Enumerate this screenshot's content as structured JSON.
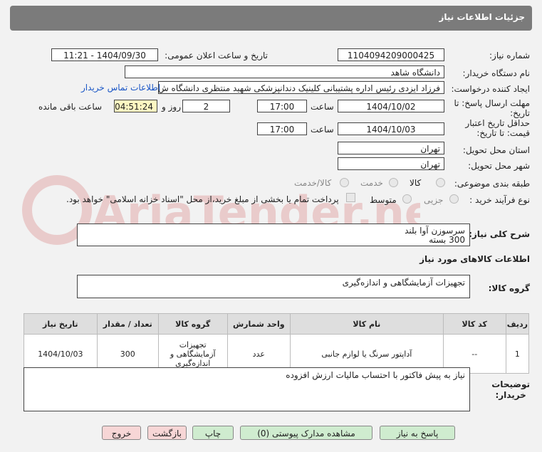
{
  "header": {
    "title": "جزئیات اطلاعات نیاز"
  },
  "fields": {
    "need_number_label": "شماره نیاز:",
    "need_number": "1104094209000425",
    "announce_label": "تاریخ و ساعت اعلان عمومی:",
    "announce_value": "1404/09/30 - 11:21",
    "buyer_org_label": "نام دستگاه خریدار:",
    "buyer_org": "دانشگاه شاهد",
    "creator_label": "ایجاد کننده درخواست:",
    "creator": "فرزاد ایزدی رئیس اداره پشتیبانی کلینیک دندانپزشکی شهید منتظری دانشگاه ش",
    "contact_link": "اطلاعات تماس خریدار",
    "deadline_label": "مهلت ارسال پاسخ: تا تاریخ:",
    "deadline_date": "1404/10/02",
    "time_label": "ساعت",
    "deadline_time": "17:00",
    "days_value": "2",
    "days_label": "روز و",
    "remaining_time": "04:51:24",
    "remaining_label": "ساعت باقی مانده",
    "validity_label": "حداقل تاریخ اعتبار قیمت: تا تاریخ:",
    "validity_date": "1404/10/03",
    "validity_time": "17:00",
    "province_label": "استان محل تحویل:",
    "province": "تهران",
    "city_label": "شهر محل تحویل:",
    "city": "تهران",
    "category_label": "طبقه بندی موضوعی:",
    "category_options": [
      "کالا",
      "خدمت",
      "کالا/خدمت"
    ],
    "process_label": "نوع فرآیند خرید :",
    "process_options": [
      "جزیی",
      "متوسط"
    ],
    "payment_note": "پرداخت تمام یا بخشی از مبلغ خرید،از محل \"اسناد خزانه اسلامی\" خواهد بود."
  },
  "summary": {
    "label": "شرح کلی نیاز:",
    "line1": "سرسوزن آوا بلند",
    "line2": "300 بسته"
  },
  "goods": {
    "section_title": "اطلاعات کالاهای مورد نیاز",
    "group_label": "گروه کالا:",
    "group_value": "تجهیزات آزمایشگاهی و اندازه‌گیری"
  },
  "table": {
    "headers": [
      "ردیف",
      "کد کالا",
      "نام کالا",
      "واحد شمارش",
      "گروه کالا",
      "تعداد / مقدار",
      "تاریخ نیاز"
    ],
    "rows": [
      {
        "row": "1",
        "code": "--",
        "name": "آداپتور سرنگ یا لوازم جانبی",
        "unit": "عدد",
        "group": "تجهیزات آزمایشگاهی و اندازه‌گیری",
        "qty": "300",
        "date": "1404/10/03"
      }
    ]
  },
  "notes": {
    "label_line1": "توضیحات",
    "label_line2": "خریدار:",
    "text": "نیاز به پیش فاکتور با احتساب مالیات ارزش افزوده"
  },
  "buttons": {
    "reply": "پاسخ به نیاز",
    "docs": "مشاهده مدارک پیوستی (0)",
    "print": "چاپ",
    "back": "بازگشت",
    "exit": "خروج"
  },
  "watermark": {
    "text": "AriaTender.net"
  }
}
